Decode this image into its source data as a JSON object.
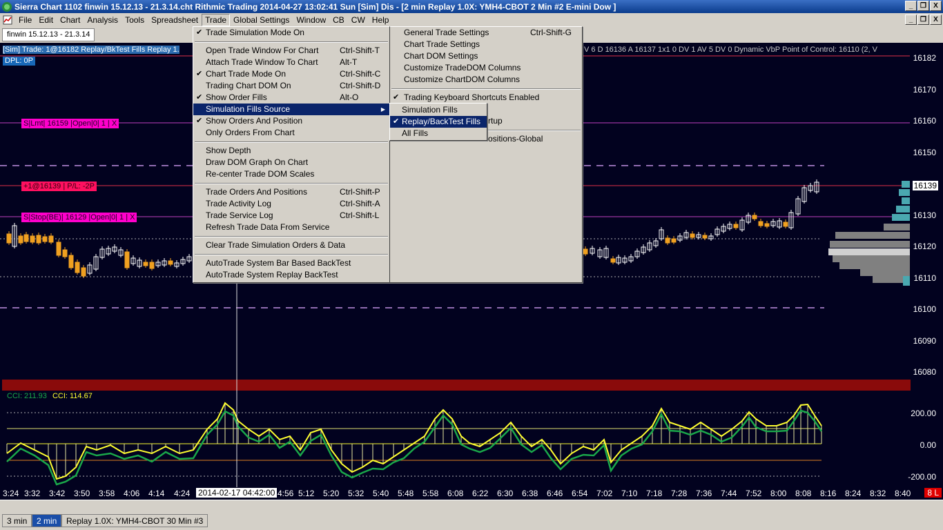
{
  "window": {
    "title": "Sierra Chart 1102 finwin 15.12.13 - 21.3.14.cht  Rithmic Trading 2014-04-27  13:02:41 Sun [Sim]  Dis - [2 min  Replay 1.0X: YMH4-CBOT  2 Min  #2  E-mini Dow ]",
    "buttons": [
      "_",
      "❐",
      "X"
    ]
  },
  "menubar": {
    "items": [
      "File",
      "Edit",
      "Chart",
      "Analysis",
      "Tools",
      "Spreadsheet",
      "Trade",
      "Global Settings",
      "Window",
      "CB",
      "CW",
      "Help"
    ],
    "mnemonics": [
      "F",
      "E",
      "C",
      "A",
      "T",
      "S",
      "T",
      "G",
      "W",
      "C",
      "C",
      "H"
    ],
    "active": "Trade"
  },
  "chart_tab": "finwin 15.12.13 - 21.3.14",
  "chart": {
    "info_line": "[Sim]  Trade: 1@16182  Replay/BkTest Fills  Replay 1.",
    "info_line_right": "V  6  D  16136  A  16137  1x1  0  DV  1  AV  5  DV  0  Dynamic VbP  Point of Control: 16110   (2, V",
    "dpl": "DPL: 0P",
    "orders": {
      "limit": "S|Lmt| 16159 |Open|0| 1 | X",
      "position": "+1@16139 | P/L: -2P",
      "stop": "S|Stop(BE)| 16129 |Open|0| 1 | X"
    },
    "price_labels": [
      "16182",
      "16170",
      "16160",
      "16150",
      "16139",
      "16130",
      "16120",
      "16110",
      "16100",
      "16090",
      "16080"
    ],
    "last_price": "16139",
    "cci": {
      "label1": "CCI: 211.93",
      "label2": "CCI: 114.67",
      "levels": [
        "200.00",
        "0.00",
        "-200.00"
      ],
      "color1": "#1aa84a",
      "color2": "#ffff30"
    },
    "colors": {
      "background": "#02021f",
      "up_bar": "#ffffff",
      "down_bar": "#f0a020",
      "volume_profile": "#808080",
      "volume_profile_recent": "#4aa8b0",
      "order_line": "#c040c0"
    }
  },
  "time_axis": {
    "labels": [
      "3:24",
      "3:32",
      "3:42",
      "3:50",
      "3:58",
      "4:06",
      "4:14",
      "4:24",
      "4:56",
      "5:12",
      "5:20",
      "5:32",
      "5:40",
      "5:48",
      "5:58",
      "6:08",
      "6:22",
      "6:30",
      "6:38",
      "6:46",
      "6:54",
      "7:02",
      "7:10",
      "7:18",
      "7:28",
      "7:36",
      "7:44",
      "7:52",
      "8:00",
      "8:08",
      "8:16",
      "8:24",
      "8:32",
      "8:40"
    ],
    "cursor": "2014-02-17  04:42:00",
    "bar_count": "8 L"
  },
  "bottom_tabs": [
    "3 min",
    "2 min",
    "Replay 1.0X: YMH4-CBOT  30 Min  #3"
  ],
  "bottom_selected": "2 min",
  "trade_menu": {
    "col1": [
      {
        "label": "Trade Simulation Mode On",
        "checked": true,
        "shortcut": ""
      },
      {
        "sep": true
      },
      {
        "label": "Open Trade Window For Chart",
        "checked": false,
        "shortcut": "Ctrl-Shift-T"
      },
      {
        "label": "Attach Trade Window To Chart",
        "checked": false,
        "shortcut": "Alt-T"
      },
      {
        "label": "Chart Trade Mode On",
        "checked": true,
        "shortcut": "Ctrl-Shift-C"
      },
      {
        "label": "Trading Chart DOM On",
        "checked": false,
        "shortcut": "Ctrl-Shift-D"
      },
      {
        "label": "Show Order Fills",
        "checked": true,
        "shortcut": "Alt-O"
      },
      {
        "label": "Simulation Fills Source",
        "checked": false,
        "shortcut": "",
        "submenu": true,
        "highlighted": true
      },
      {
        "label": "Show Orders And Position",
        "checked": true,
        "shortcut": ""
      },
      {
        "label": "Only Orders From Chart",
        "checked": false,
        "shortcut": ""
      },
      {
        "sep": true
      },
      {
        "label": "Show Depth",
        "checked": false,
        "shortcut": ""
      },
      {
        "label": "Draw DOM Graph On Chart",
        "checked": false,
        "shortcut": ""
      },
      {
        "label": "Re-center Trade DOM Scales",
        "checked": false,
        "shortcut": ""
      },
      {
        "sep": true
      },
      {
        "label": "Trade Orders And Positions",
        "checked": false,
        "shortcut": "Ctrl-Shift-P"
      },
      {
        "label": "Trade Activity Log",
        "checked": false,
        "shortcut": "Ctrl-Shift-A"
      },
      {
        "label": "Trade Service Log",
        "checked": false,
        "shortcut": "Ctrl-Shift-L"
      },
      {
        "label": "Refresh Trade Data From Service",
        "checked": false,
        "shortcut": ""
      },
      {
        "sep": true
      },
      {
        "label": "Clear Trade Simulation Orders & Data",
        "checked": false,
        "shortcut": ""
      },
      {
        "sep": true
      },
      {
        "label": "AutoTrade System Bar Based BackTest",
        "checked": false,
        "shortcut": ""
      },
      {
        "label": "AutoTrade System Replay BackTest",
        "checked": false,
        "shortcut": ""
      }
    ],
    "col2": [
      {
        "label": "General Trade Settings",
        "checked": false,
        "shortcut": "Ctrl-Shift-G"
      },
      {
        "label": "Chart Trade Settings",
        "checked": false,
        "shortcut": ""
      },
      {
        "label": "Chart DOM Settings",
        "checked": false,
        "shortcut": ""
      },
      {
        "label": "Customize TradeDOM Columns",
        "checked": false,
        "shortcut": ""
      },
      {
        "label": "Customize ChartDOM Columns",
        "checked": false,
        "shortcut": ""
      },
      {
        "sep": true
      },
      {
        "label": "Trading Keyboard Shortcuts Enabled",
        "checked": true,
        "shortcut": ""
      },
      {
        "label": "",
        "checked": false,
        "shortcut": ""
      },
      {
        "label": "Startup",
        "checked": false,
        "shortcut": "",
        "indent": true
      },
      {
        "sep": true
      },
      {
        "label": "...Positions-Global",
        "checked": false,
        "shortcut": "",
        "indent": true
      }
    ]
  },
  "fills_submenu": [
    {
      "label": "Simulation Fills",
      "checked": false
    },
    {
      "label": "Replay/BackTest Fills",
      "checked": true,
      "highlighted": true
    },
    {
      "label": "All Fills",
      "checked": false
    }
  ]
}
